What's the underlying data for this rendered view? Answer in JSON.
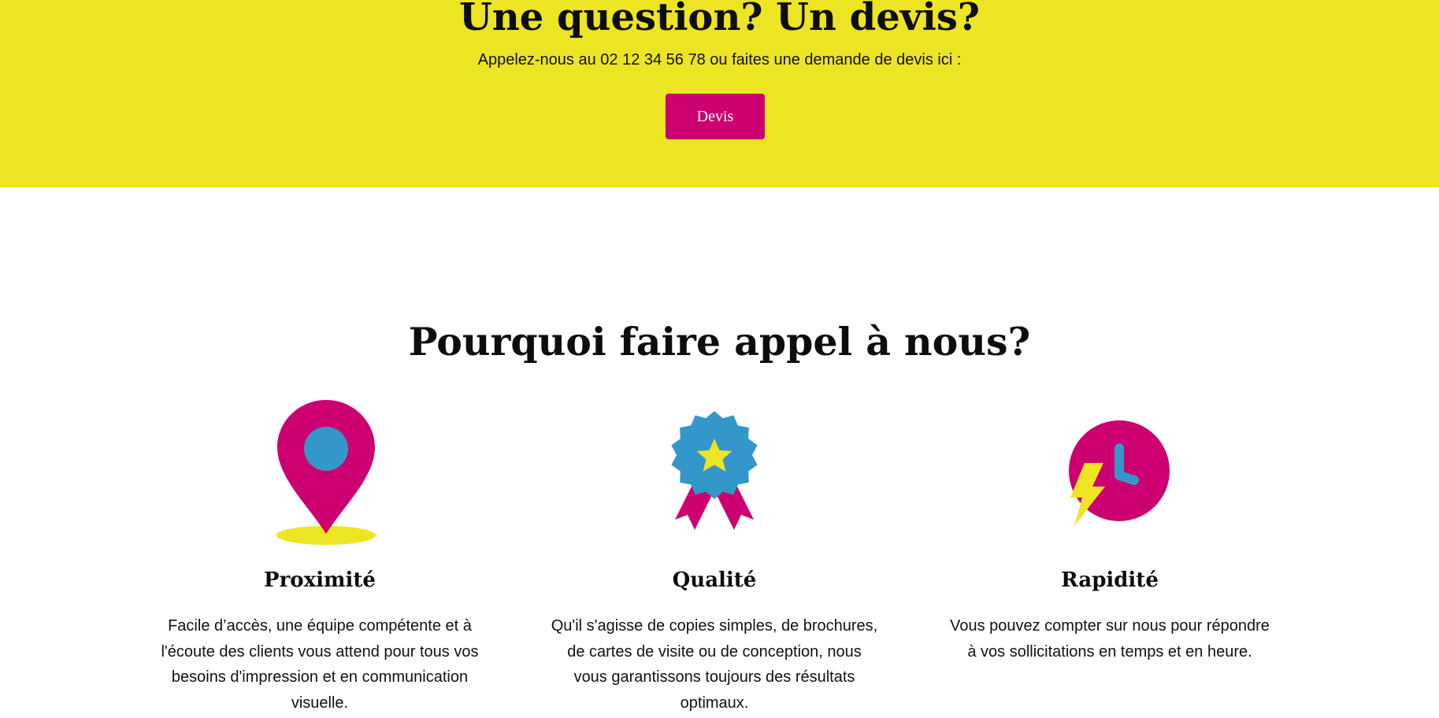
{
  "cta": {
    "title": "Une question? Un devis?",
    "text": "Appelez-nous au 02 12 34 56 78 ou faites une demande de devis ici :",
    "button_label": "Devis",
    "background_color": "#ede423",
    "button_color": "#cc0070"
  },
  "why": {
    "title": "Pourquoi faire appel à nous?",
    "features": [
      {
        "icon": "map-pin-icon",
        "title": "Proximité",
        "text": "Facile d’accès, une équipe compétente et à l'écoute des clients vous attend pour tous vos besoins d'impression et en communication visuelle."
      },
      {
        "icon": "award-ribbon-icon",
        "title": "Qualité",
        "text": "Qu'il s'agisse de copies simples, de brochures, de cartes de visite ou de conception, nous vous garantissons toujours des résultats optimaux."
      },
      {
        "icon": "fast-clock-icon",
        "title": "Rapidité",
        "text": "Vous pouvez compter sur nous pour répondre à vos sollicitations en temps et en heure."
      }
    ]
  },
  "colors": {
    "magenta": "#cc0070",
    "blue": "#3497c9",
    "yellow": "#ede423"
  }
}
